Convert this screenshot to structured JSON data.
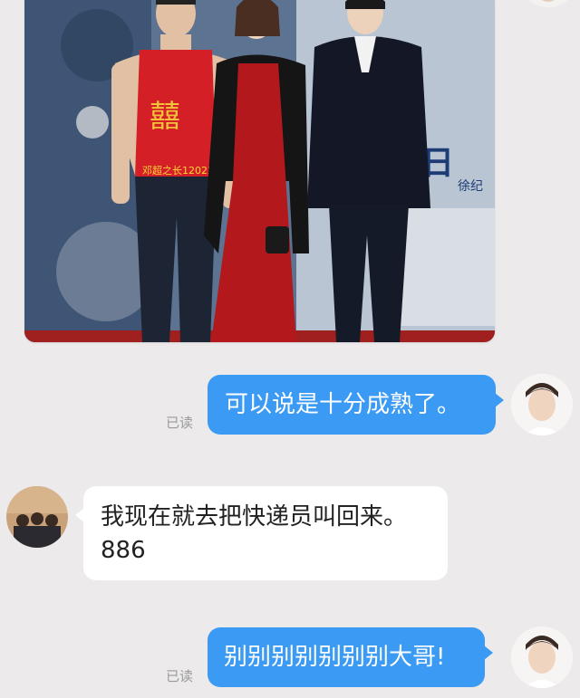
{
  "messages": [
    {
      "type": "image",
      "side": "incoming",
      "alt_text": "红毯合照"
    },
    {
      "type": "text",
      "side": "outgoing",
      "text": "可以说是十分成熟了。",
      "status": "已读"
    },
    {
      "type": "text",
      "side": "incoming",
      "lines": [
        "我现在就去把快递员叫回来。",
        "886"
      ]
    },
    {
      "type": "text",
      "side": "outgoing",
      "text": "别别别别别别别大哥!",
      "status": "已读"
    }
  ],
  "photo_sign": {
    "apron_char": "囍",
    "apron_text": "邓超之长12022",
    "poster_big": "日",
    "poster_name": "徐纪"
  },
  "colors": {
    "outgoing_bubble": "#3b9af3",
    "incoming_bubble": "#ffffff",
    "background": "#eceaeb"
  }
}
